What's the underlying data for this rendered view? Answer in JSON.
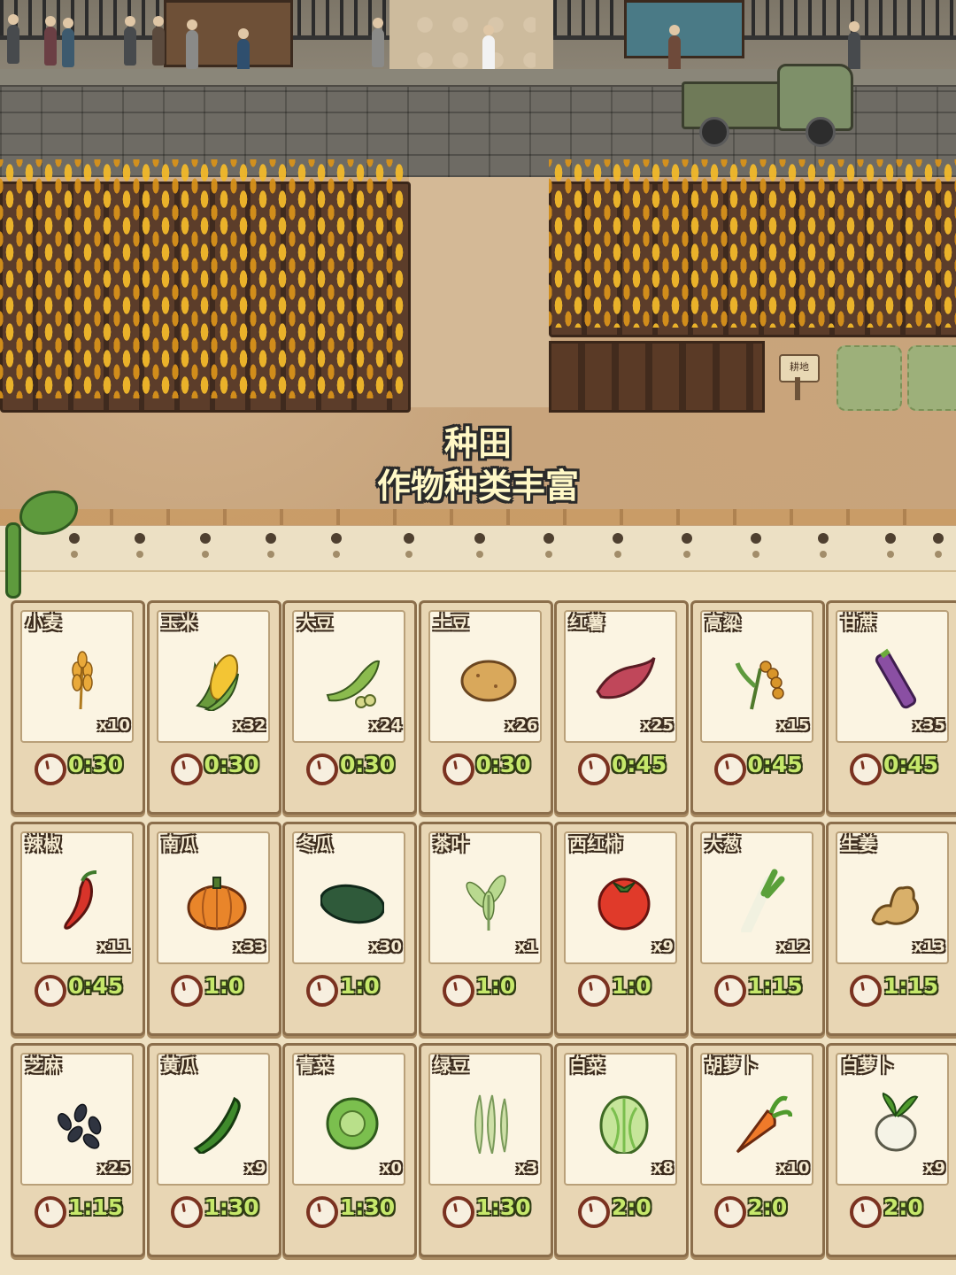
{
  "scene": {
    "caption_line1": "种田",
    "caption_line2": "作物种类丰富",
    "field_sign": "耕地"
  },
  "crops": [
    {
      "name": "小麦",
      "count": "x10",
      "time": "0:30",
      "icon": "wheat-icon"
    },
    {
      "name": "玉米",
      "count": "x32",
      "time": "0:30",
      "icon": "corn-icon"
    },
    {
      "name": "大豆",
      "count": "x24",
      "time": "0:30",
      "icon": "soybean-icon"
    },
    {
      "name": "土豆",
      "count": "x26",
      "time": "0:30",
      "icon": "potato-icon"
    },
    {
      "name": "红薯",
      "count": "x25",
      "time": "0:45",
      "icon": "sweet-potato-icon"
    },
    {
      "name": "高粱",
      "count": "x15",
      "time": "0:45",
      "icon": "sorghum-icon"
    },
    {
      "name": "甘蔗",
      "count": "x35",
      "time": "0:45",
      "icon": "sugarcane-icon"
    },
    {
      "name": "辣椒",
      "count": "x11",
      "time": "0:45",
      "icon": "chili-icon"
    },
    {
      "name": "南瓜",
      "count": "x33",
      "time": "1:0",
      "icon": "pumpkin-icon"
    },
    {
      "name": "冬瓜",
      "count": "x30",
      "time": "1:0",
      "icon": "winter-melon-icon"
    },
    {
      "name": "茶叶",
      "count": "x1",
      "time": "1:0",
      "icon": "tea-leaf-icon"
    },
    {
      "name": "西红柿",
      "count": "x9",
      "time": "1:0",
      "icon": "tomato-icon"
    },
    {
      "name": "大葱",
      "count": "x12",
      "time": "1:15",
      "icon": "scallion-icon"
    },
    {
      "name": "生姜",
      "count": "x13",
      "time": "1:15",
      "icon": "ginger-icon"
    },
    {
      "name": "芝麻",
      "count": "x25",
      "time": "1:15",
      "icon": "sesame-icon"
    },
    {
      "name": "黄瓜",
      "count": "x9",
      "time": "1:30",
      "icon": "cucumber-icon"
    },
    {
      "name": "青菜",
      "count": "x0",
      "time": "1:30",
      "icon": "bok-choy-icon"
    },
    {
      "name": "绿豆",
      "count": "x3",
      "time": "1:30",
      "icon": "mung-bean-icon"
    },
    {
      "name": "白菜",
      "count": "x8",
      "time": "2:0",
      "icon": "napa-cabbage-icon"
    },
    {
      "name": "胡萝卜",
      "count": "x10",
      "time": "2:0",
      "icon": "carrot-icon"
    },
    {
      "name": "白萝卜",
      "count": "x9",
      "time": "2:0",
      "icon": "radish-icon"
    }
  ]
}
